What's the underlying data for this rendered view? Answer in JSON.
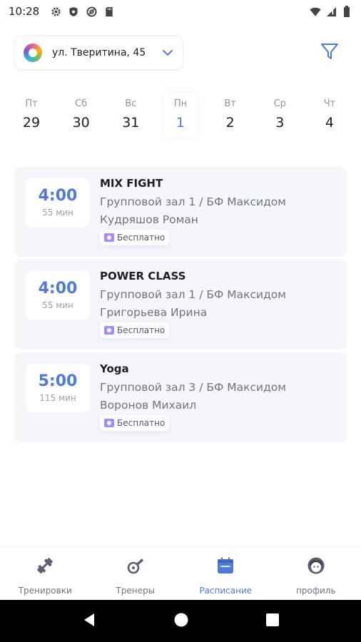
{
  "status_bar": {
    "time": "10:28",
    "icons_left": [
      "gear-icon",
      "shield-icon",
      "vpn-icon",
      "sd-card-icon"
    ],
    "icons_right": [
      "wifi-icon",
      "signal-icon",
      "battery-icon"
    ]
  },
  "location": {
    "address": "ул. Тверитина, 45"
  },
  "days": [
    {
      "name": "Пт",
      "num": "29",
      "active": false
    },
    {
      "name": "Сб",
      "num": "30",
      "active": false
    },
    {
      "name": "Вс",
      "num": "31",
      "active": false
    },
    {
      "name": "Пн",
      "num": "1",
      "active": true
    },
    {
      "name": "Вт",
      "num": "2",
      "active": false
    },
    {
      "name": "Ср",
      "num": "3",
      "active": false
    },
    {
      "name": "Чт",
      "num": "4",
      "active": false
    }
  ],
  "sessions": [
    {
      "time": "4:00",
      "duration": "55 мин",
      "title": "MIX FIGHT",
      "hall": "Групповой зал 1 / БФ Максидом",
      "coach": "Кудряшов Роман",
      "price": "Бесплатно"
    },
    {
      "time": "4:00",
      "duration": "55 мин",
      "title": "POWER CLASS",
      "hall": "Групповой зал 1 / БФ Максидом",
      "coach": "Григорьева Ирина",
      "price": "Бесплатно"
    },
    {
      "time": "5:00",
      "duration": "115 мин",
      "title": "Yoga",
      "hall": "Групповой зал 3 / БФ Максидом",
      "coach": "Воронов Михаил",
      "price": "Бесплатно"
    }
  ],
  "nav": [
    {
      "label": "Тренировки",
      "icon": "dumbbell-icon",
      "active": false
    },
    {
      "label": "Тренеры",
      "icon": "whistle-icon",
      "active": false
    },
    {
      "label": "Расписание",
      "icon": "calendar-icon",
      "active": true
    },
    {
      "label": "профиль",
      "icon": "profile-icon",
      "active": false
    }
  ],
  "colors": {
    "accent": "#4e7bd9",
    "card_bg": "#f5f6fa",
    "price_icon": "#a78bfa"
  }
}
